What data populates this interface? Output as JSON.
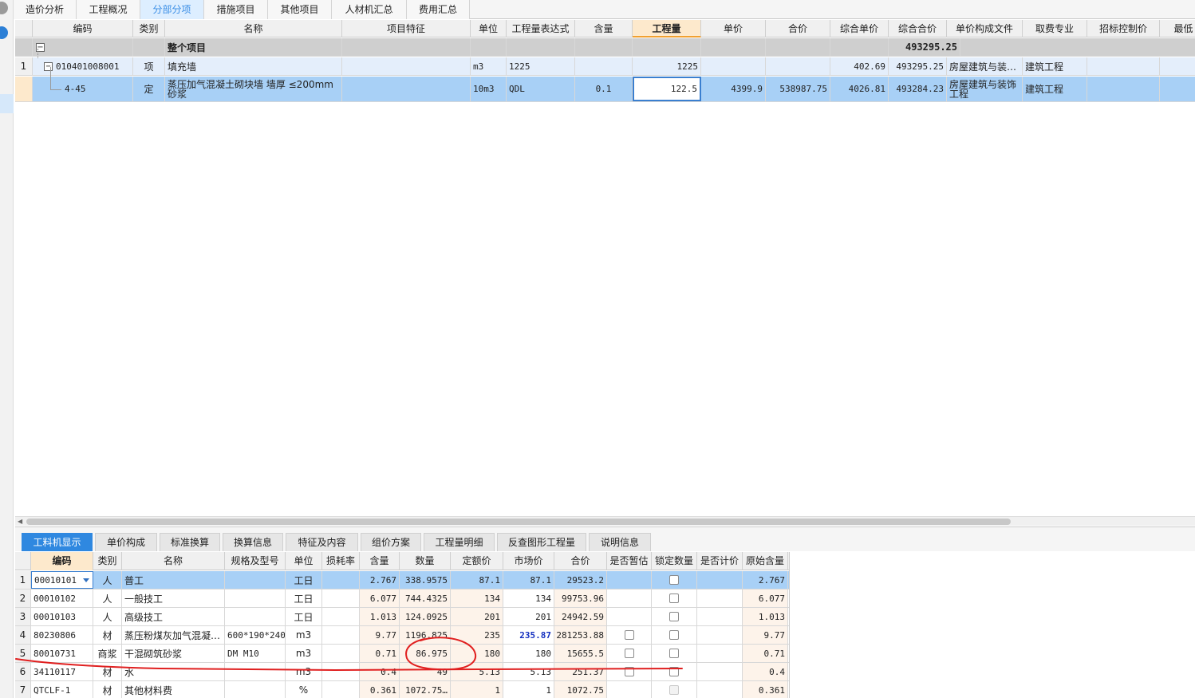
{
  "top_tabs": [
    "造价分析",
    "工程概况",
    "分部分项",
    "措施项目",
    "其他项目",
    "人材机汇总",
    "费用汇总"
  ],
  "active_top_tab": "分部分项",
  "upper_grid": {
    "headers": [
      "编码",
      "类别",
      "名称",
      "项目特征",
      "单位",
      "工程量表达式",
      "含量",
      "工程量",
      "单价",
      "合价",
      "综合单价",
      "综合合价",
      "单价构成文件",
      "取费专业",
      "招标控制价",
      "最低"
    ],
    "total_row": {
      "toggle": "−",
      "name": "整个项目",
      "zhhj": "493295.25"
    },
    "rows": [
      {
        "index": "1",
        "toggle": "−",
        "code": "010401008001",
        "type": "项",
        "name": "填充墙",
        "unit": "m3",
        "expr": "1225",
        "hanliang": "",
        "quantity": "1225",
        "price": "",
        "total": "",
        "zhdj": "402.69",
        "zhhj": "493295.25",
        "file": "房屋建筑与装…",
        "zhuanye": "建筑工程"
      },
      {
        "index": "",
        "toggle": "",
        "code": "4-45",
        "type": "定",
        "name": "蒸压加气混凝土砌块墙 墙厚 ≤200mm 砂浆",
        "unit": "10m3",
        "expr": "QDL",
        "hanliang": "0.1",
        "quantity": "122.5",
        "price": "4399.9",
        "total": "538987.75",
        "zhdj": "4026.81",
        "zhhj": "493284.23",
        "file": "房屋建筑与装饰工程",
        "zhuanye": "建筑工程"
      }
    ]
  },
  "bottom_tabs": [
    "工料机显示",
    "单价构成",
    "标准换算",
    "换算信息",
    "特征及内容",
    "组价方案",
    "工程量明细",
    "反查图形工程量",
    "说明信息"
  ],
  "active_bottom_tab": "工料机显示",
  "lower_grid": {
    "headers": [
      "编码",
      "类别",
      "名称",
      "规格及型号",
      "单位",
      "损耗率",
      "含量",
      "数量",
      "定额价",
      "市场价",
      "合价",
      "是否暂估",
      "锁定数量",
      "是否计价",
      "原始含量"
    ],
    "rows": [
      {
        "index": "1",
        "code": "00010101",
        "type": "人",
        "name": "普工",
        "spec": "",
        "unit": "工日",
        "loss": "",
        "hanliang": "2.767",
        "qty": "338.9575",
        "base": "87.1",
        "market": "87.1",
        "total": "29523.2",
        "zangu": false,
        "lock": true,
        "orig": "2.767"
      },
      {
        "index": "2",
        "code": "00010102",
        "type": "人",
        "name": "一般技工",
        "spec": "",
        "unit": "工日",
        "loss": "",
        "hanliang": "6.077",
        "qty": "744.4325",
        "base": "134",
        "market": "134",
        "total": "99753.96",
        "zangu": false,
        "lock": true,
        "orig": "6.077"
      },
      {
        "index": "3",
        "code": "00010103",
        "type": "人",
        "name": "高级技工",
        "spec": "",
        "unit": "工日",
        "loss": "",
        "hanliang": "1.013",
        "qty": "124.0925",
        "base": "201",
        "market": "201",
        "total": "24942.59",
        "zangu": false,
        "lock": true,
        "orig": "1.013"
      },
      {
        "index": "4",
        "code": "80230806",
        "type": "材",
        "name": "蒸压粉煤灰加气混凝…",
        "spec": "600*190*240",
        "unit": "m3",
        "loss": "",
        "hanliang": "9.77",
        "qty": "1196.825",
        "base": "235",
        "market": "235.87",
        "total": "281253.88",
        "zangu": true,
        "lock": true,
        "orig": "9.77"
      },
      {
        "index": "5",
        "code": "80010731",
        "type": "商浆",
        "name": "干混砌筑砂浆",
        "spec": "DM M10",
        "unit": "m3",
        "loss": "",
        "hanliang": "0.71",
        "qty": "86.975",
        "base": "180",
        "market": "180",
        "total": "15655.5",
        "zangu": true,
        "lock": true,
        "orig": "0.71"
      },
      {
        "index": "6",
        "code": "34110117",
        "type": "材",
        "name": "水",
        "spec": "",
        "unit": "m3",
        "loss": "",
        "hanliang": "0.4",
        "qty": "49",
        "base": "5.13",
        "market": "5.13",
        "total": "251.37",
        "zangu": true,
        "lock": true,
        "orig": "0.4"
      },
      {
        "index": "7",
        "code": "QTCLF-1",
        "type": "材",
        "name": "其他材料费",
        "spec": "",
        "unit": "%",
        "loss": "",
        "hanliang": "0.361",
        "qty": "1072.75…",
        "base": "1",
        "market": "1",
        "total": "1072.75",
        "zangu": false,
        "lock": false,
        "orig": "0.361"
      }
    ]
  },
  "colors": {
    "accent": "#2f88e0",
    "selected_row": "#a8d0f6",
    "annotation": "#e02020",
    "market_highlight": "#1430c0"
  }
}
